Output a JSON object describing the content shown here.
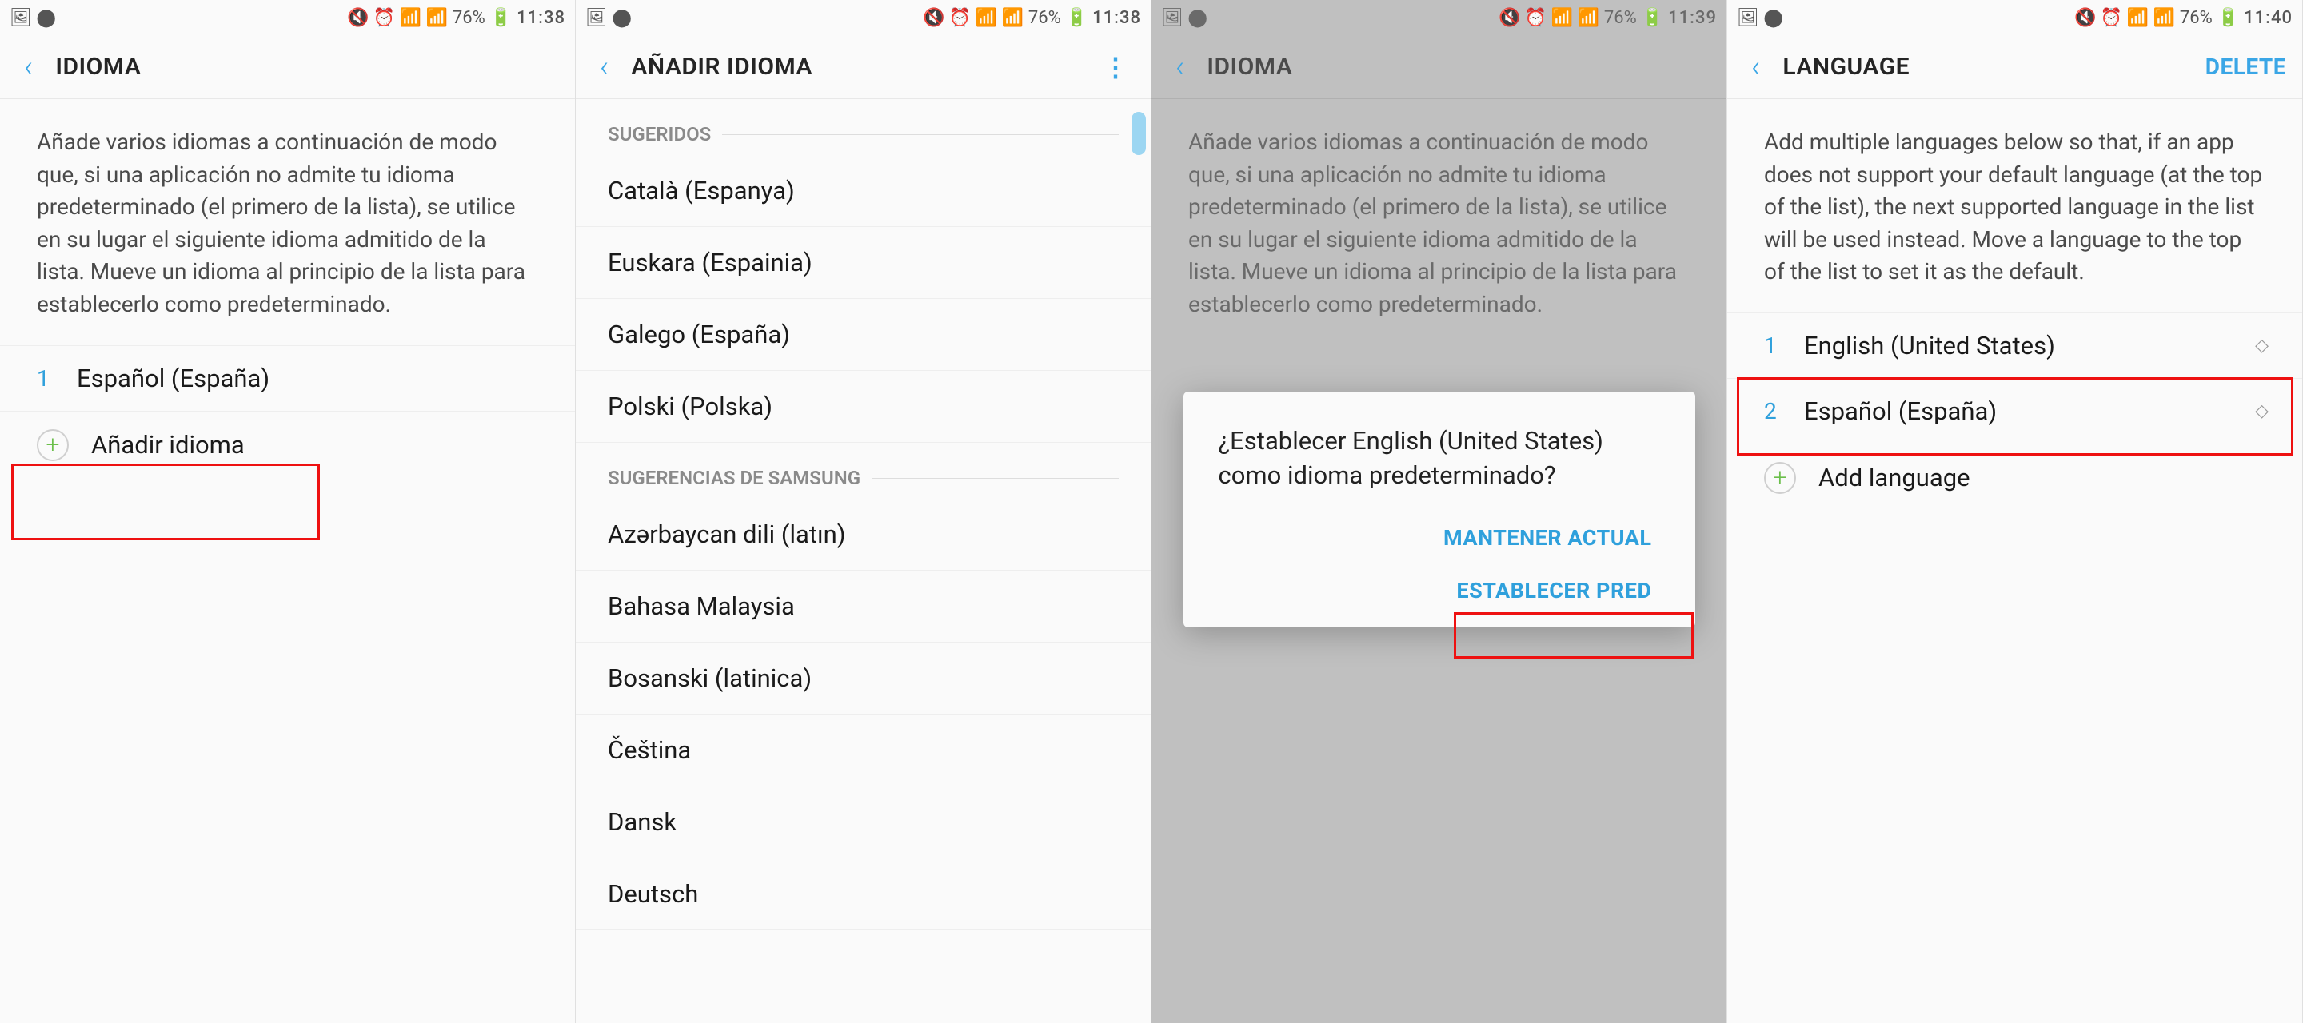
{
  "statusbar": {
    "left_icons": "🖼 ⬤",
    "right_icons": "🔇 ⏰ 📶 📶",
    "battery": "76%",
    "times": [
      "11:38",
      "11:38",
      "11:39",
      "11:40"
    ]
  },
  "screens": [
    {
      "title": "IDIOMA",
      "desc": "Añade varios idiomas a continuación de modo que, si una aplicación no admite tu idioma predeterminado (el primero de la lista), se utilice en su lugar el siguiente idioma admitido de la lista. Mueve un idioma al principio de la lista para establecerlo como predeterminado.",
      "languages": [
        {
          "num": "1",
          "label": "Español (España)"
        }
      ],
      "add_label": "Añadir idioma"
    },
    {
      "title": "AÑADIR IDIOMA",
      "sections": [
        {
          "label": "SUGERIDOS",
          "items": [
            "Català (Espanya)",
            "Euskara (Espainia)",
            "Galego (España)",
            "Polski (Polska)"
          ]
        },
        {
          "label": "SUGERENCIAS DE SAMSUNG",
          "items": [
            "Azərbaycan dili (latın)",
            "Bahasa Malaysia",
            "Bosanski (latinica)",
            "Čeština",
            "Dansk",
            "Deutsch"
          ]
        }
      ]
    },
    {
      "title": "IDIOMA",
      "desc": "Añade varios idiomas a continuación de modo que, si una aplicación no admite tu idioma predeterminado (el primero de la lista), se utilice en su lugar el siguiente idioma admitido de la lista. Mueve un idioma al principio de la lista para establecerlo como predeterminado.",
      "dialog": {
        "message": "¿Establecer English (United States) como idioma predeterminado?",
        "keep": "MANTENER ACTUAL",
        "set": "ESTABLECER PRED"
      }
    },
    {
      "title": "LANGUAGE",
      "delete": "DELETE",
      "desc": "Add multiple languages below so that, if an app does not support your default language (at the top of the list), the next supported language in the list will be used instead. Move a language to the top of the list to set it as the default.",
      "languages": [
        {
          "num": "1",
          "label": "English (United States)"
        },
        {
          "num": "2",
          "label": "Español (España)"
        }
      ],
      "add_label": "Add language"
    }
  ]
}
